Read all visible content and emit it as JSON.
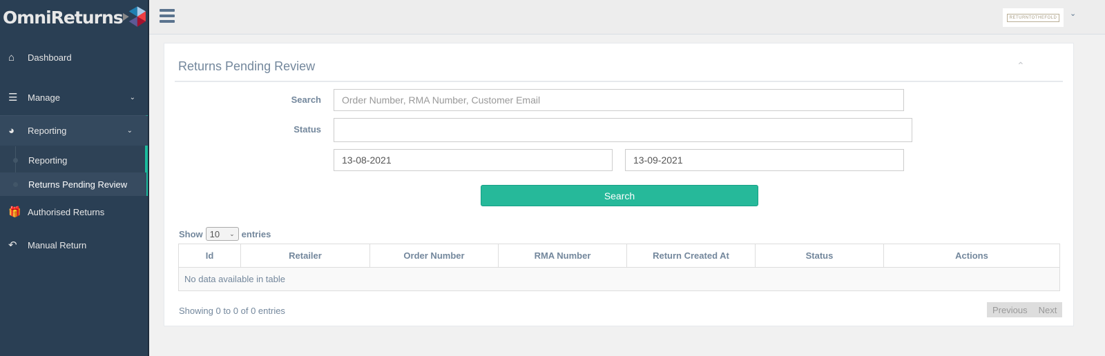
{
  "brand": {
    "name": "OmniReturns",
    "colors": [
      "#1f7fb1",
      "#a9cbe9",
      "#ef3e42",
      "#a3132f",
      "#5e5a96",
      "#8a8a8a"
    ]
  },
  "topbar": {
    "menu_icon": "hamburger-icon",
    "account_logo": "RETURNTOTHEFOLD"
  },
  "sidebar": {
    "items": [
      {
        "label": "Dashboard",
        "icon": "home-icon"
      },
      {
        "label": "Manage",
        "icon": "bars-icon"
      },
      {
        "label": "Reporting",
        "icon": "pie-chart-icon",
        "sub": [
          {
            "label": "Reporting"
          },
          {
            "label": "Returns Pending Review"
          }
        ]
      },
      {
        "label": "Authorised Returns",
        "icon": "gift-icon"
      },
      {
        "label": "Manual Return",
        "icon": "reply-icon"
      }
    ],
    "accent": "#1abb9c"
  },
  "panel": {
    "title": "Returns Pending Review",
    "search_label": "Search",
    "search_placeholder": "Order Number, RMA Number, Customer Email",
    "search_value": "",
    "status_label": "Status",
    "status_value": "",
    "date_from": "13-08-2021",
    "date_to": "13-09-2021",
    "search_button": "Search",
    "button_color": "#26b99a"
  },
  "table": {
    "show": "Show",
    "page_size": "10",
    "entries": "entries",
    "columns": [
      "Id",
      "Retailer",
      "Order Number",
      "RMA Number",
      "Return Created At",
      "Status",
      "Actions"
    ],
    "empty": "No data available in table",
    "info": "Showing 0 to 0 of 0 entries",
    "prev": "Previous",
    "next": "Next"
  }
}
